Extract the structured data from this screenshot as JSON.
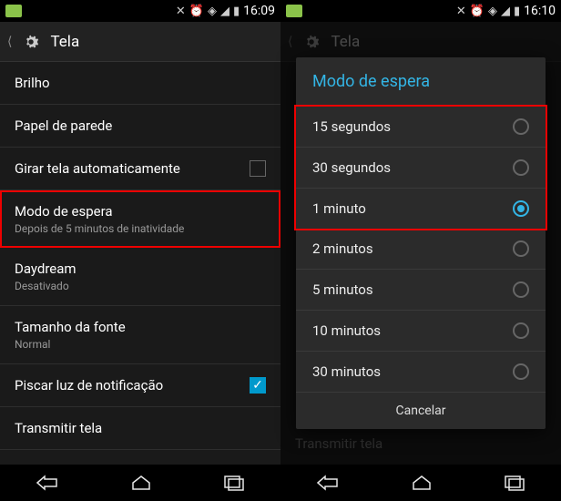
{
  "left": {
    "time": "16:09",
    "title": "Tela",
    "items": [
      {
        "label": "Brilho"
      },
      {
        "label": "Papel de parede"
      },
      {
        "label": "Girar tela automaticamente",
        "checkbox": false
      },
      {
        "label": "Modo de espera",
        "sub": "Depois de 5 minutos de inatividade",
        "highlight": true
      },
      {
        "label": "Daydream",
        "sub": "Desativado"
      },
      {
        "label": "Tamanho da fonte",
        "sub": "Normal"
      },
      {
        "label": "Piscar luz de notificação",
        "checkbox": true
      },
      {
        "label": "Transmitir tela"
      }
    ]
  },
  "right": {
    "time": "16:10",
    "title": "Tela",
    "dialog_title": "Modo de espera",
    "options": [
      {
        "label": "15 segundos",
        "selected": false,
        "hl": true
      },
      {
        "label": "30 segundos",
        "selected": false,
        "hl": true
      },
      {
        "label": "1 minuto",
        "selected": true,
        "hl": true
      },
      {
        "label": "2 minutos",
        "selected": false
      },
      {
        "label": "5 minutos",
        "selected": false
      },
      {
        "label": "10 minutos",
        "selected": false
      },
      {
        "label": "30 minutos",
        "selected": false
      }
    ],
    "cancel": "Cancelar",
    "bg_item": "Transmitir tela"
  }
}
